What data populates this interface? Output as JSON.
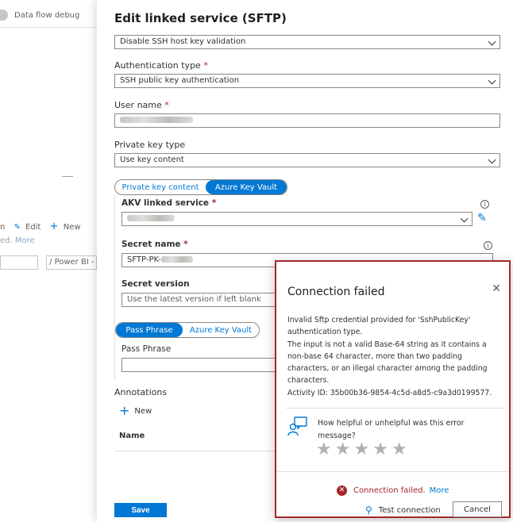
{
  "background": {
    "debug_label": "Data flow debug",
    "edit_label": "Edit",
    "new_label": "New",
    "failed_text": "ed.",
    "more_link": "More",
    "power_bi": "Power BI -"
  },
  "panel": {
    "title": "Edit linked service (SFTP)",
    "host_key_option": "Disable SSH host key validation",
    "auth_type_label": "Authentication type",
    "auth_type_value": "SSH public key authentication",
    "user_name_label": "User name",
    "private_key_type_label": "Private key type",
    "private_key_type_value": "Use key content",
    "key_tabs": [
      "Private key content",
      "Azure Key Vault"
    ],
    "akv_label": "AKV linked service",
    "secret_name_label": "Secret name",
    "secret_name_prefix": "SFTP-PK-",
    "secret_version_label": "Secret version",
    "secret_version_placeholder": "Use the latest version if left blank",
    "pass_tabs": [
      "Pass Phrase",
      "Azure Key Vault"
    ],
    "pass_phrase_label": "Pass Phrase",
    "annotations_label": "Annotations",
    "new_label": "New",
    "name_header": "Name",
    "save_label": "Save",
    "required_mark": "*",
    "info_glyph": "i"
  },
  "dialog": {
    "title": "Connection failed",
    "close_glyph": "✕",
    "message_lines": [
      "Invalid Sftp credential provided for 'SshPublicKey'",
      "authentication type.",
      "The input is not a valid Base-64 string as it contains a",
      "non-base 64 character, more than two padding",
      "characters, or an illegal character among the padding",
      "characters.",
      "Activity ID: 35b00b36-9854-4c5d-a8d5-c9a3d0199577."
    ],
    "feedback_question": [
      "How helpful or unhelpful was this error",
      "message?"
    ],
    "rating_max": 5,
    "status_text": "Connection failed.",
    "more_link": "More",
    "test_connection": "Test connection",
    "cancel": "Cancel"
  },
  "colors": {
    "accent": "#0078d4",
    "error": "#a4262c"
  }
}
